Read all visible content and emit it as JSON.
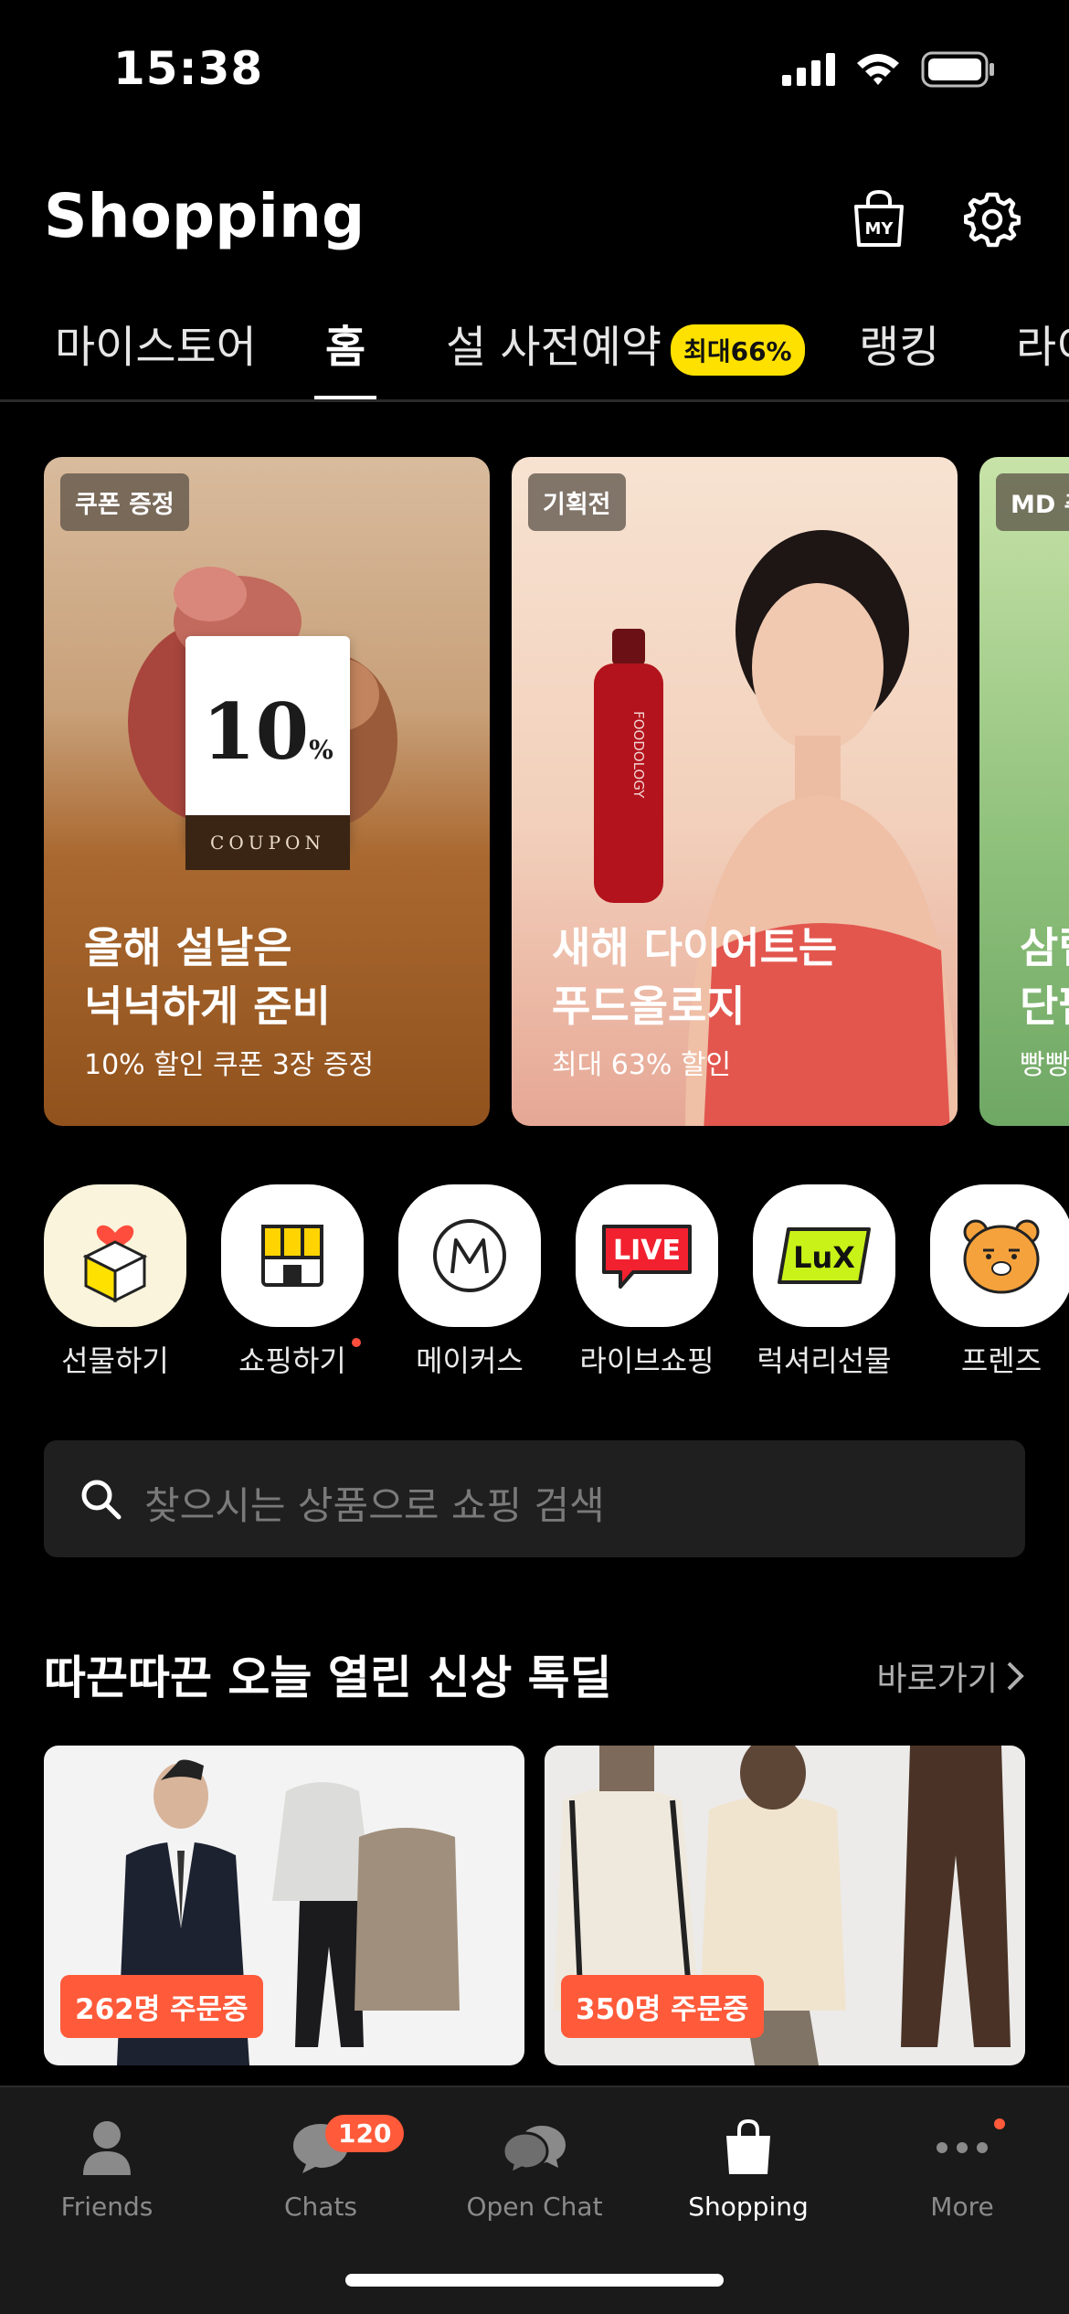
{
  "status_bar": {
    "time": "15:38"
  },
  "header": {
    "title": "Shopping",
    "my_label": "MY"
  },
  "tabs": [
    {
      "label": "마이스토어"
    },
    {
      "label": "홈"
    },
    {
      "label": "설 사전예약",
      "badge": "최대66%"
    },
    {
      "label": "랭킹"
    },
    {
      "label": "라이"
    }
  ],
  "banners": [
    {
      "tag": "쿠폰 증정",
      "title": "올해 설날은\n넉넉하게 준비",
      "subtitle": "10% 할인 쿠폰 3장 증정",
      "coupon_value": "10",
      "coupon_unit": "%",
      "coupon_label": "COUPON"
    },
    {
      "tag": "기획전",
      "title": "새해 다이어트는\n푸드올로지",
      "subtitle": "최대 63% 할인",
      "bottle_text": "FOODOLOGY"
    },
    {
      "tag": "MD 추",
      "title": "삼립\n단팥",
      "subtitle": "빵빵"
    }
  ],
  "categories": [
    {
      "label": "선물하기",
      "icon": "gift-box-icon"
    },
    {
      "label": "쇼핑하기",
      "icon": "store-icon",
      "new_dot": true
    },
    {
      "label": "메이커스",
      "icon": "makers-icon"
    },
    {
      "label": "라이브쇼핑",
      "icon": "live-icon",
      "icon_text": "LIVE"
    },
    {
      "label": "럭셔리선물",
      "icon": "luxury-icon",
      "icon_text": "LuX"
    },
    {
      "label": "프렌즈",
      "icon": "friends-ryan-icon"
    }
  ],
  "search": {
    "placeholder": "찾으시는 상품으로 쇼핑 검색"
  },
  "section": {
    "title": "따끈따끈 오늘 열린 신상 톡딜",
    "link": "바로가기"
  },
  "products": [
    {
      "badge": "262명 주문중"
    },
    {
      "badge": "350명 주문중"
    }
  ],
  "tabbar": [
    {
      "label": "Friends",
      "icon": "person-icon"
    },
    {
      "label": "Chats",
      "icon": "chat-bubble-icon",
      "badge": "120"
    },
    {
      "label": "Open Chat",
      "icon": "open-chat-icon"
    },
    {
      "label": "Shopping",
      "icon": "shopping-bag-icon",
      "active": true
    },
    {
      "label": "More",
      "icon": "more-dots-icon",
      "dot": true
    }
  ],
  "colors": {
    "badge_yellow": "#ffe100",
    "accent_orange": "#ff5a3a",
    "background": "#000000"
  }
}
